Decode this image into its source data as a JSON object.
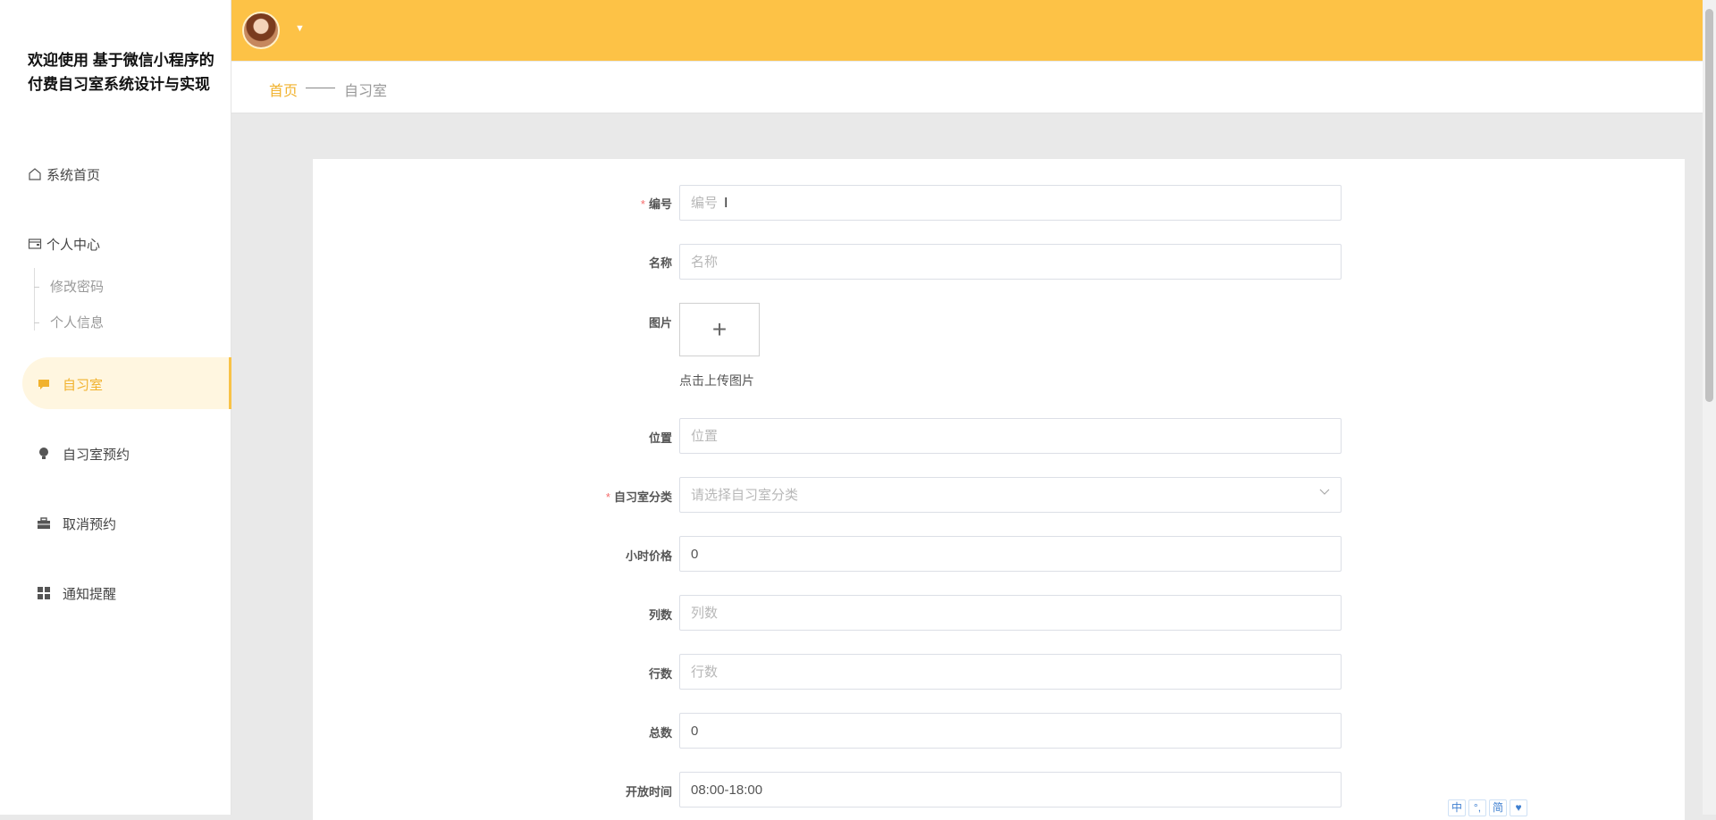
{
  "sidebar": {
    "title": "欢迎使用 基于微信小程序的付费自习室系统设计与实现",
    "home": {
      "label": "系统首页",
      "icon": "home-icon"
    },
    "personal_center": {
      "label": "个人中心",
      "icon": "wallet-icon",
      "children": [
        {
          "label": "修改密码"
        },
        {
          "label": "个人信息"
        }
      ]
    },
    "groups": [
      {
        "label": "自习室",
        "icon": "chat-icon",
        "active": true
      },
      {
        "label": "自习室预约",
        "icon": "bulb-icon",
        "active": false
      },
      {
        "label": "取消预约",
        "icon": "briefcase-icon",
        "active": false
      },
      {
        "label": "通知提醒",
        "icon": "grid-icon",
        "active": false
      }
    ]
  },
  "header": {
    "accent_color": "#fdc246",
    "avatar_icon": "user-avatar",
    "caret_icon": "caret-down-icon"
  },
  "breadcrumb": {
    "home": "首页",
    "current": "自习室"
  },
  "form": {
    "code": {
      "label": "编号",
      "required": true,
      "value": "",
      "placeholder": "编号"
    },
    "name": {
      "label": "名称",
      "required": false,
      "value": "",
      "placeholder": "名称"
    },
    "image": {
      "label": "图片",
      "upload_hint": "点击上传图片",
      "icon": "plus-icon"
    },
    "location": {
      "label": "位置",
      "required": false,
      "value": "",
      "placeholder": "位置"
    },
    "category": {
      "label": "自习室分类",
      "required": true,
      "value": "",
      "placeholder": "请选择自习室分类"
    },
    "hourly_price": {
      "label": "小时价格",
      "required": false,
      "value": "0",
      "placeholder": ""
    },
    "columns": {
      "label": "列数",
      "required": false,
      "value": "",
      "placeholder": "列数"
    },
    "rows": {
      "label": "行数",
      "required": false,
      "value": "",
      "placeholder": "行数"
    },
    "total": {
      "label": "总数",
      "required": false,
      "value": "0",
      "placeholder": ""
    },
    "open_time": {
      "label": "开放时间",
      "required": false,
      "value": "08:00-18:00",
      "placeholder": ""
    }
  },
  "ime_toolbar": [
    "中",
    "°,",
    "简",
    "♥"
  ]
}
